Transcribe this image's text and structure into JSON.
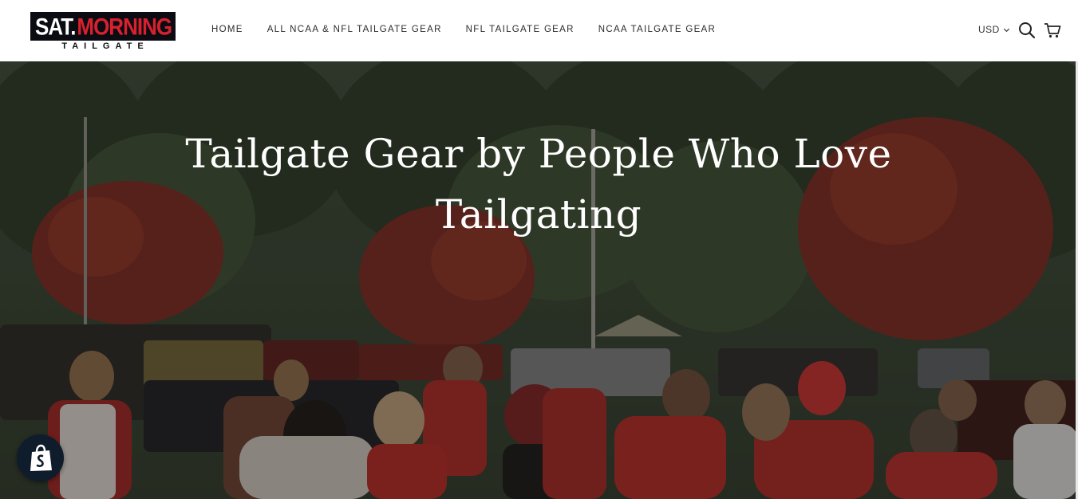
{
  "logo": {
    "line1_a": "SAT.",
    "line1_b": "MORNING",
    "line2": "TAILGATE",
    "colors": {
      "dark": "#0b0b12",
      "red": "#d8202f"
    }
  },
  "nav": {
    "items": [
      {
        "label": "HOME"
      },
      {
        "label": "ALL NCAA & NFL TAILGATE GEAR"
      },
      {
        "label": "NFL TAILGATE GEAR"
      },
      {
        "label": "NCAA TAILGATE GEAR"
      }
    ]
  },
  "header_tools": {
    "currency": "USD",
    "search_icon": "search-icon",
    "cart_icon": "cart-icon",
    "currency_chevron_icon": "chevron-down-icon"
  },
  "hero": {
    "title": "Tailgate Gear by People Who Love Tailgating",
    "image": "tailgate-crowd-photo"
  },
  "badge": {
    "icon": "shopify-bag-icon"
  }
}
